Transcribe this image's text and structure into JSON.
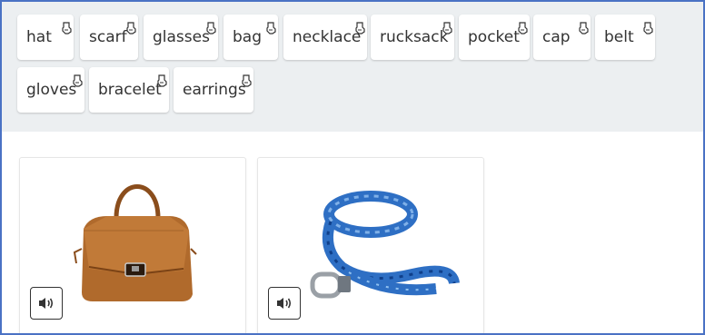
{
  "word_bank": {
    "chips": [
      {
        "label": "hat"
      },
      {
        "label": "scarf"
      },
      {
        "label": "glasses"
      },
      {
        "label": "bag"
      },
      {
        "label": "necklace"
      },
      {
        "label": "rucksack"
      },
      {
        "label": "pocket"
      },
      {
        "label": "cap"
      },
      {
        "label": "belt"
      },
      {
        "label": "gloves"
      },
      {
        "label": "bracelet"
      },
      {
        "label": "earrings"
      }
    ],
    "grip_icon": "drag-hand-icon"
  },
  "cards": [
    {
      "image": "brown-handbag",
      "audio_icon": "speaker-icon"
    },
    {
      "image": "blue-belt",
      "audio_icon": "speaker-icon"
    }
  ],
  "colors": {
    "frame_border": "#4a72c4",
    "bank_background": "#eceff1",
    "chip_text": "#333333",
    "bag_brown": "#b06a2c",
    "belt_blue": "#2e6fc4"
  }
}
